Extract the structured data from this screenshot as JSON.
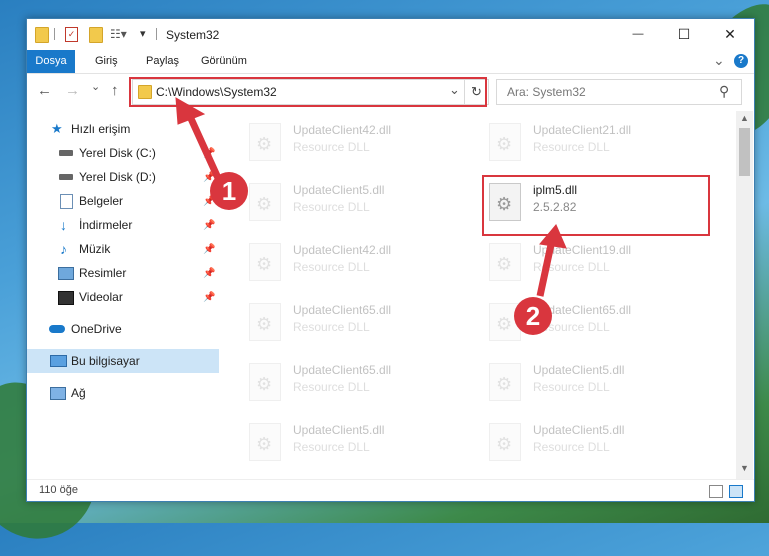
{
  "window": {
    "title": "System32",
    "minimize_glyph": "—",
    "maximize_glyph": "☐",
    "close_glyph": "✕"
  },
  "ribbon": {
    "tabs": [
      "Dosya",
      "Giriş",
      "Paylaş",
      "Görünüm"
    ],
    "expand_glyph": "⌄",
    "help_glyph": "?"
  },
  "navigation": {
    "back_glyph": "←",
    "forward_glyph": "→",
    "recent_glyph": "⌄",
    "up_glyph": "↑",
    "address_value": "C:\\Windows\\System32",
    "address_dropdown_glyph": "⌄",
    "refresh_glyph": "↻",
    "search_placeholder": "Ara: System32",
    "search_glyph": "⚲"
  },
  "sidebar": {
    "items": [
      {
        "label": "Hızlı erişim",
        "icon": "star-icon"
      },
      {
        "label": "Yerel Disk (C:)",
        "icon": "drive-icon"
      },
      {
        "label": "Yerel Disk (D:)",
        "icon": "drive-icon"
      },
      {
        "label": "Belgeler",
        "icon": "documents-icon"
      },
      {
        "label": "İndirmeler",
        "icon": "download-icon"
      },
      {
        "label": "Müzik",
        "icon": "music-icon"
      },
      {
        "label": "Resimler",
        "icon": "pictures-icon"
      },
      {
        "label": "Videolar",
        "icon": "video-icon"
      },
      {
        "label": "OneDrive",
        "icon": "cloud-icon"
      },
      {
        "label": "Bu bilgisayar",
        "icon": "computer-icon"
      },
      {
        "label": "Ağ",
        "icon": "network-icon"
      }
    ]
  },
  "files": {
    "left": [
      {
        "name": "UpdateClient42.dll",
        "type": "Resource DLL"
      },
      {
        "name": "UpdateClient5.dll",
        "type": "Resource DLL"
      },
      {
        "name": "UpdateClient42.dll",
        "type": "Resource DLL"
      },
      {
        "name": "UpdateClient65.dll",
        "type": "Resource DLL"
      },
      {
        "name": "UpdateClient65.dll",
        "type": "Resource DLL"
      },
      {
        "name": "UpdateClient5.dll",
        "type": "Resource DLL"
      }
    ],
    "right": [
      {
        "name": "UpdateClient21.dll",
        "type": "Resource DLL"
      },
      {
        "name": "iplm5.dll",
        "type": "2.5.2.82"
      },
      {
        "name": "UpdateClient19.dll",
        "type": "Resource DLL"
      },
      {
        "name": "UpdateClient65.dll",
        "type": "Resource DLL"
      },
      {
        "name": "UpdateClient5.dll",
        "type": "Resource DLL"
      },
      {
        "name": "UpdateClient5.dll",
        "type": "Resource DLL"
      }
    ]
  },
  "status": {
    "item_count": "110 öğe"
  },
  "annotations": {
    "step1": "1",
    "step2": "2",
    "color": "#d9363e"
  },
  "colors": {
    "accent": "#1979ca",
    "selection": "#cce4f7"
  }
}
